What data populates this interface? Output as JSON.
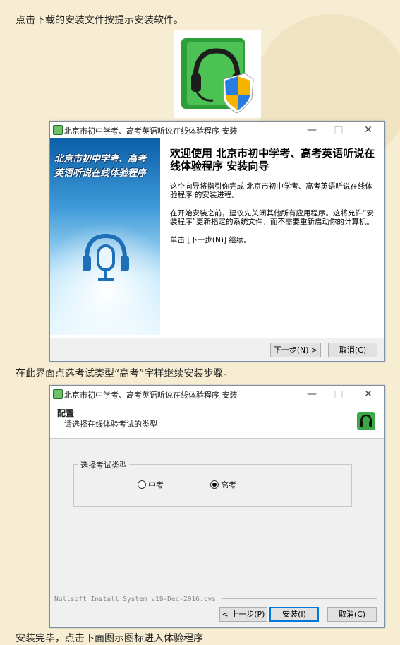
{
  "intro_text": "点击下载的安装文件按提示安装软件。",
  "mid_text": "在此界面点选考试类型“高考”字样继续安装步骤。",
  "bottom_text": "安装完毕，点击下面图示图标进入体验程序",
  "installer_icon": "headset-shield-installer-icon",
  "window1": {
    "title": "北京市初中学考、高考英语听说在线体验程序 安装",
    "banner_line1": "北京市初中学考、高考",
    "banner_line2": "英语听说在线体验程序",
    "heading": "欢迎使用 北京市初中学考、高考英语听说在线体验程序 安装向导",
    "para1": "这个向导将指引你完成 北京市初中学考、高考英语听说在线体验程序 的安装进程。",
    "para2": "在开始安装之前，建议先关闭其他所有应用程序。这将允许“安装程序”更新指定的系统文件，而不需要重新启动你的计算机。",
    "para3": "单击 [下一步(N)] 继续。",
    "next_label": "下一步(N) >",
    "cancel_label": "取消(C)"
  },
  "window2": {
    "title": "北京市初中学考、高考英语听说在线体验程序 安装",
    "section_title": "配置",
    "section_subtitle": "请选择在线体验考试的类型",
    "group_label": "选择考试类型",
    "options": [
      {
        "label": "中考",
        "selected": false
      },
      {
        "label": "高考",
        "selected": true
      }
    ],
    "nsis_text": "Nullsoft Install System v19-Dec-2016.cvs",
    "back_label": "< 上一步(P)",
    "install_label": "安装(I)",
    "cancel_label": "取消(C)"
  },
  "colors": {
    "page_bg": "#f6edd2",
    "accent": "#0078d7",
    "icon_green": "#3aa845"
  }
}
